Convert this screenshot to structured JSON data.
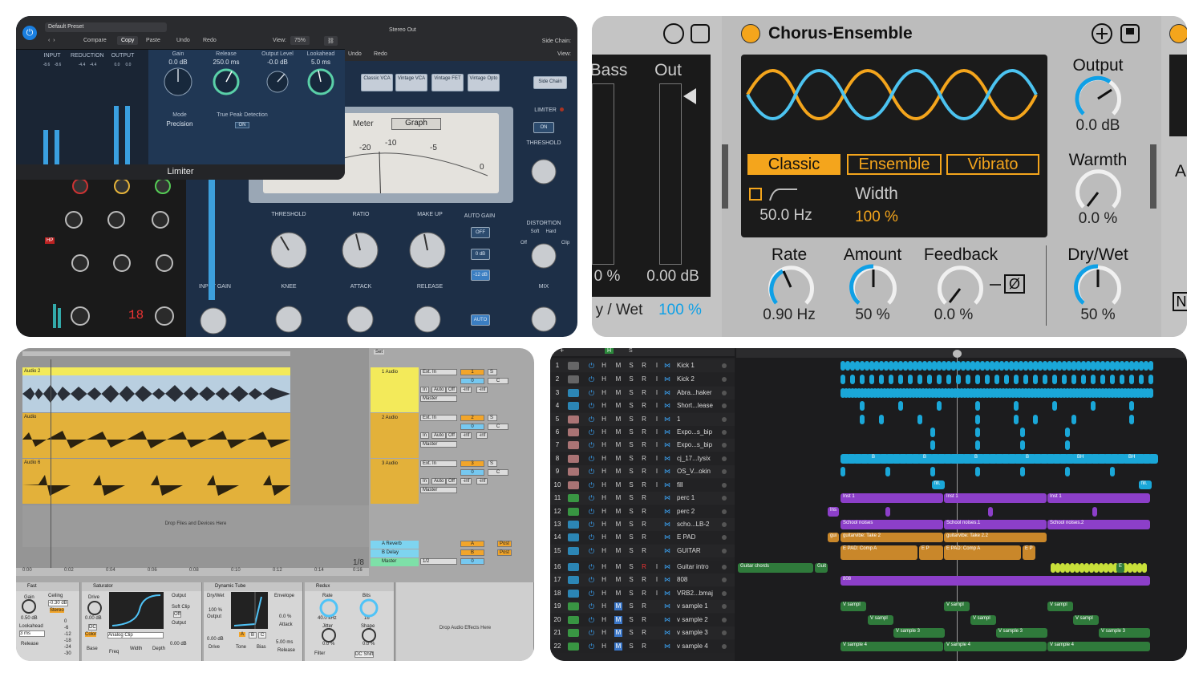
{
  "limiter": {
    "preset": "Default Preset",
    "toolbar": {
      "compare": "Compare",
      "copy": "Copy",
      "paste": "Paste",
      "undo": "Undo",
      "redo": "Redo",
      "view_label": "View:",
      "view_value": "75%"
    },
    "meter_labels": {
      "input": "INPUT",
      "reduction": "REDUCTION",
      "output": "OUTPUT"
    },
    "meter_peaks": {
      "input_l": "-8.6",
      "input_r": "-8.6",
      "reduction_l": "-4.4",
      "reduction_r": "-4.4",
      "output_l": "0.0",
      "output_r": "0.0"
    },
    "knobs": [
      {
        "label": "Gain",
        "value": "0.0 dB"
      },
      {
        "label": "Release",
        "value": "250.0 ms"
      },
      {
        "label": "Output Level",
        "value": "-0.0 dB"
      },
      {
        "label": "Lookahead",
        "value": "5.0 ms"
      }
    ],
    "mode_label": "Mode",
    "mode_value": "Precision",
    "true_peak_label": "True Peak Detection",
    "true_peak_value": "ON",
    "footer": "Limiter"
  },
  "compressor": {
    "title": "Stereo Out",
    "side_chain_label": "Side Chain:",
    "view_label": "View:",
    "undo": "Undo",
    "redo": "Redo",
    "models": [
      "Classic VCA",
      "Vintage VCA",
      "Vintage FET",
      "Vintage Opto"
    ],
    "side_chain_btn": "Side Chain",
    "meter_tabs": [
      "Meter",
      "Graph"
    ],
    "meter_scale": [
      "-20",
      "-10",
      "-5",
      "0"
    ],
    "limiter_label": "LIMITER",
    "limiter_on": "ON",
    "knob_labels": [
      "THRESHOLD",
      "RATIO",
      "MAKE UP",
      "AUTO GAIN",
      "KNEE",
      "ATTACK",
      "RELEASE",
      "INPUT GAIN",
      "DISTORTION",
      "MIX",
      "THRESHOLD"
    ],
    "auto_gain": [
      "OFF",
      "0 dB",
      "-12 dB"
    ],
    "auto_btn": "AUTO",
    "distortion_opts": [
      "Soft",
      "Hard",
      "Off",
      "Clip"
    ],
    "channel_strip": {
      "peak": "18",
      "hp": "HP"
    }
  },
  "chorus": {
    "title": "Chorus-Ensemble",
    "modes": [
      "Classic",
      "Ensemble",
      "Vibrato"
    ],
    "freq_value": "50.0 Hz",
    "width_label": "Width",
    "width_value": "100 %",
    "output_label": "Output",
    "output_value": "0.0 dB",
    "warmth_label": "Warmth",
    "warmth_value": "0.0 %",
    "rate_label": "Rate",
    "rate_value": "0.90 Hz",
    "amount_label": "Amount",
    "amount_value": "50 %",
    "feedback_label": "Feedback",
    "feedback_value": "0.0 %",
    "invert": "Ø",
    "drywet_label": "Dry/Wet",
    "drywet_value": "50 %",
    "left": {
      "bass": "Bass",
      "out": "Out",
      "pct": "0 %",
      "out_db": "0.00 dB",
      "drywet_label": "y / Wet",
      "drywet_value": "100 %"
    },
    "right_fragments": [
      "A",
      "N"
    ],
    "colors": {
      "accent": "#f4a51c",
      "wave_orange": "#f4a51c",
      "wave_blue": "#4cc3f0"
    }
  },
  "ableton": {
    "clips": [
      "Audio 2",
      "Audio",
      "Audio 6"
    ],
    "tracks": [
      {
        "name": "1 Audio",
        "num": "1"
      },
      {
        "name": "2 Audio",
        "num": "2"
      },
      {
        "name": "3 Audio",
        "num": "3"
      }
    ],
    "io": {
      "ext_in": "Ext. In",
      "in": "In",
      "auto": "Auto",
      "off": "Off",
      "master": "Master",
      "inf": "-inf",
      "s": "S",
      "c": "C",
      "zero": "0"
    },
    "drop_files": "Drop Files and Devices Here",
    "returns": [
      {
        "name": "A Reverb",
        "letter": "A"
      },
      {
        "name": "B Delay",
        "letter": "B"
      }
    ],
    "master": {
      "name": "Master",
      "sel": "1/2",
      "zero": "0"
    },
    "post": "Post",
    "set": "Set",
    "pager": "1/8",
    "ruler": [
      "0:00",
      "0:02",
      "0:04",
      "0:06",
      "0:08",
      "0:10",
      "0:12",
      "0:14",
      "0:16"
    ],
    "devices": {
      "fast": {
        "title": "Fast",
        "gain": "Gain",
        "gain_value": "0.50 dB",
        "ceiling": "Ceiling",
        "ceiling_value": "-0.30 dB",
        "stereo": "Stereo",
        "lookahead": "Lookahead",
        "lookahead_value": "3 ms",
        "release": "Release",
        "scale": [
          "0",
          "-6",
          "-12",
          "-18",
          "-24",
          "-30"
        ]
      },
      "saturator": {
        "title": "Saturator",
        "drive": "Drive",
        "drive_value": "0.00 dB",
        "dc": "DC",
        "color": "Color",
        "curve": "Analog Clip",
        "output": "Output",
        "output_value": "0.00 dB",
        "soft_clip": "Soft Clip",
        "soft_clip_value": "Off",
        "base": "Base",
        "freq": "Freq",
        "width": "Width",
        "depth": "Depth"
      },
      "tube": {
        "title": "Dynamic Tube",
        "drywet": "Dry/Wet",
        "drywet_value": "100 %",
        "output": "Output",
        "output_value": "0.00 dB",
        "drive": "Drive",
        "tone": "Tone",
        "bias": "Bias",
        "types": [
          "A",
          "B",
          "C"
        ],
        "envelope": "Envelope",
        "envelope_value": "0.0 %",
        "attack": "Attack",
        "attack_value": "5.00 ms",
        "release": "Release"
      },
      "redux": {
        "title": "Redux",
        "rate": "Rate",
        "rate_value": "40.0 kHz",
        "jitter": "Jitter",
        "jitter_value": "0.0 %",
        "bits": "Bits",
        "bits_value": "16",
        "shape": "Shape",
        "shape_value": "0.0 %",
        "filter": "Filter",
        "dc_shift": "DC Shift"
      },
      "drop_effects": "Drop Audio Effects Here"
    }
  },
  "logic": {
    "header_btns": [
      "+",
      "H",
      "S"
    ],
    "track_btns": [
      "H",
      "M",
      "S",
      "R",
      "I"
    ],
    "tracks": [
      {
        "num": "1",
        "name": "Kick 1"
      },
      {
        "num": "2",
        "name": "Kick 2"
      },
      {
        "num": "3",
        "name": "Abra...haker"
      },
      {
        "num": "4",
        "name": "Short...lease"
      },
      {
        "num": "5",
        "name": "1"
      },
      {
        "num": "6",
        "name": "Expo...s_bip"
      },
      {
        "num": "7",
        "name": "Expo...s_bip"
      },
      {
        "num": "8",
        "name": "cj_17...tysix"
      },
      {
        "num": "9",
        "name": "OS_V...okin"
      },
      {
        "num": "10",
        "name": "fill"
      },
      {
        "num": "11",
        "name": "perc 1"
      },
      {
        "num": "12",
        "name": "perc 2"
      },
      {
        "num": "13",
        "name": "scho...LB-2"
      },
      {
        "num": "14",
        "name": "E PAD"
      },
      {
        "num": "15",
        "name": "GUITAR"
      },
      {
        "num": "16",
        "name": "Guitar intro"
      },
      {
        "num": "17",
        "name": "808"
      },
      {
        "num": "18",
        "name": "VRB2...bmaj"
      },
      {
        "num": "19",
        "name": "v sample 1"
      },
      {
        "num": "20",
        "name": "v sample 2"
      },
      {
        "num": "21",
        "name": "v sample 3"
      },
      {
        "num": "22",
        "name": "v sample 4"
      }
    ],
    "regions": {
      "b": "B",
      "bh": "BH",
      "fill": "fill.",
      "inst1": "Inst 1",
      "ins": "Ins",
      "school1": "School noises",
      "school2": "School noises.1",
      "school3": "School noises.2",
      "gui": "gui",
      "gtr1": "guitarvibe: Take 2",
      "gtr2": "guitarvibe: Take 2.2",
      "epad1": "E PAD: Comp A",
      "epad2": "E P",
      "epad3": "E PAD: Comp A",
      "gchords": "Guitar chords",
      "gintro": "Guit",
      "r808": "808",
      "e": "E",
      "vs": "V sampl",
      "vs3": "V sample 3",
      "vs4": "V sample 4"
    },
    "footer_track": "Stereo Out",
    "colors": {
      "blue": "#1aa7d8",
      "purple": "#8c3fc9",
      "orange": "#c9872a",
      "green": "#2f7a3b",
      "lime": "#c8e03a"
    }
  }
}
